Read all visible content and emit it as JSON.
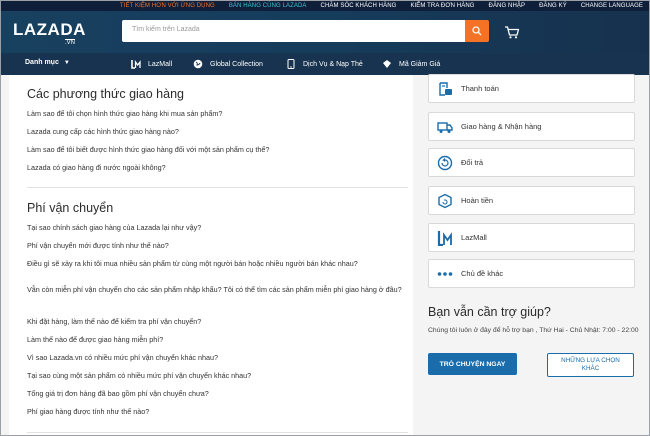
{
  "topbar": {
    "items": [
      {
        "label": "TIẾT KIỆM HƠN VỚI ỨNG DỤNG",
        "style": "hl"
      },
      {
        "label": "BÁN HÀNG CÙNG LAZADA",
        "style": "teal"
      },
      {
        "label": "CHĂM SÓC KHÁCH HÀNG",
        "style": ""
      },
      {
        "label": "KIỂM TRA ĐƠN HÀNG",
        "style": ""
      },
      {
        "label": "ĐĂNG NHẬP",
        "style": ""
      },
      {
        "label": "ĐĂNG KÝ",
        "style": ""
      },
      {
        "label": "CHANGE LANGUAGE",
        "style": ""
      }
    ]
  },
  "header": {
    "logo": "LAZADA",
    "logo_sub": ".VN",
    "search_placeholder": "Tìm kiếm trên Lazada",
    "search_icon": "search-icon",
    "cart_icon": "cart-icon"
  },
  "nav": {
    "categories": "Danh mục",
    "items": [
      {
        "label": "LazMall",
        "icon": "lazmall-icon"
      },
      {
        "label": "Global Collection",
        "icon": "globe-icon"
      },
      {
        "label": "Dịch Vụ & Nạp Thẻ",
        "icon": "phone-icon"
      },
      {
        "label": "Mã Giảm Giá",
        "icon": "coupon-icon"
      }
    ]
  },
  "sections": [
    {
      "title": "Các phương thức giao hàng",
      "questions": [
        "Làm sao để tôi chọn hình thức giao hàng khi mua sản phẩm?",
        "Lazada cung cấp các hình thức giao hàng nào?",
        "Làm sao để tôi biết được hình thức giao hàng đối với một sản phẩm cụ thể?",
        "Lazada có giao hàng đi nước ngoài không?"
      ]
    },
    {
      "title": "Phí vận chuyển",
      "questions": [
        "Tại sao chính sách giao hàng của Lazada lại như vậy?",
        "Phí vận chuyển mới được tính như thế nào?",
        "Điều gì sẽ xảy ra khi tôi mua nhiều sản phẩm từ cùng một người bán hoặc nhiều người bán khác nhau?",
        "Vẫn còn miễn phí vận chuyển cho các sản phẩm nhập khẩu? Tôi có thể tìm các sản phẩm miễn phí giao hàng ở đâu?",
        "Khi đặt hàng, làm thế nào để kiểm tra phí vận chuyển?",
        "Làm thế nào để được giao hàng miễn phí?",
        "Vì sao Lazada.vn có nhiều mức phí vận chuyển khác nhau?",
        "Tại sao cùng một sản phẩm có nhiều mức phí vận chuyển khác nhau?",
        "Tổng giá trị đơn hàng đã bao gồm phí vận chuyển chưa?",
        "Phí giao hàng được tính như thế nào?"
      ]
    }
  ],
  "sidebar": {
    "topics": [
      {
        "label": "Thanh toán",
        "icon": "payment-icon"
      },
      {
        "label": "Giao hàng & Nhận hàng",
        "icon": "truck-icon"
      },
      {
        "label": "Đổi trả",
        "icon": "return-icon"
      },
      {
        "label": "Hoàn tiền",
        "icon": "refund-icon"
      },
      {
        "label": "LazMall",
        "icon": "lazmall-icon"
      },
      {
        "label": "Chủ đề khác",
        "icon": "more-icon"
      }
    ],
    "help_title": "Bạn vẫn cần trợ giúp?",
    "help_text": "Chúng tôi luôn ở đây để hỗ trợ bạn , Thứ Hai - Chủ Nhật: 7:00 - 22:00",
    "chat_button": "TRÒ CHUYỆN NGAY",
    "other_button": "NHỮNG LỰA CHỌN KHÁC"
  },
  "colors": {
    "accent": "#f57224",
    "header_bg": "#17334f",
    "icon_blue": "#1a6cab"
  }
}
